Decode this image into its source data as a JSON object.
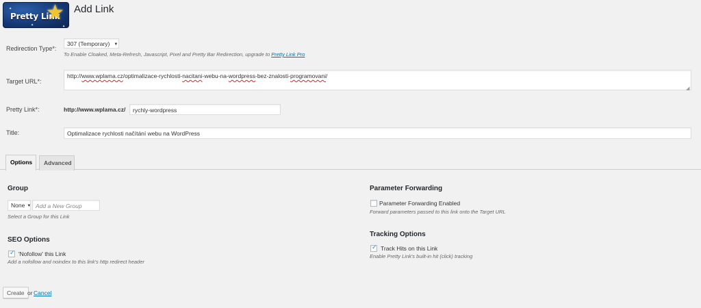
{
  "logo": {
    "text": "Pretty Link",
    "icon": "star-icon"
  },
  "page_title": "Add Link",
  "redirection": {
    "label": "Redirection Type*:",
    "selected": "307 (Temporary)",
    "hint": "To Enable Cloaked, Meta-Refresh, Javascript, Pixel and Pretty Bar Redirection, upgrade to",
    "hint_link": "Pretty Link Pro"
  },
  "target": {
    "label": "Target URL*:",
    "value_prefix": "http://",
    "value_domain": "www.wplama.cz",
    "value_sep1": "/optimalizace-rychlosti-",
    "value_w1": "nacitani",
    "value_sep2": "-webu-na-",
    "value_w2": "wordpress",
    "value_sep3": "-bez-znalosti-",
    "value_w3": "programovani",
    "value_end": "/"
  },
  "pretty_link": {
    "label": "Pretty Link*:",
    "base": "http://www.wplama.cz/",
    "slug": "rychly-wordpress"
  },
  "title_field": {
    "label": "Title:",
    "value": "Optimalizace rychlosti načítání webu na WordPress"
  },
  "tabs": [
    {
      "label": "Options"
    },
    {
      "label": "Advanced"
    }
  ],
  "group": {
    "heading": "Group",
    "selected": "None",
    "new_placeholder": "Add a New Group",
    "hint": "Select a Group for this Link"
  },
  "seo": {
    "heading": "SEO Options",
    "nofollow_label": "'Nofollow' this Link",
    "nofollow_checked": true,
    "hint": "Add a nofollow and noindex to this link's http redirect header"
  },
  "param_forwarding": {
    "heading": "Parameter Forwarding",
    "label": "Parameter Forwarding Enabled",
    "checked": false,
    "hint": "Forward parameters passed to this link onto the Target URL"
  },
  "tracking": {
    "heading": "Tracking Options",
    "label": "Track Hits on this Link",
    "checked": true,
    "hint": "Enable Pretty Link's built-in hit (click) tracking"
  },
  "actions": {
    "create": "Create",
    "or": "or",
    "cancel": "Cancel"
  },
  "colors": {
    "link": "#0073aa",
    "background": "#f1f1f1"
  }
}
